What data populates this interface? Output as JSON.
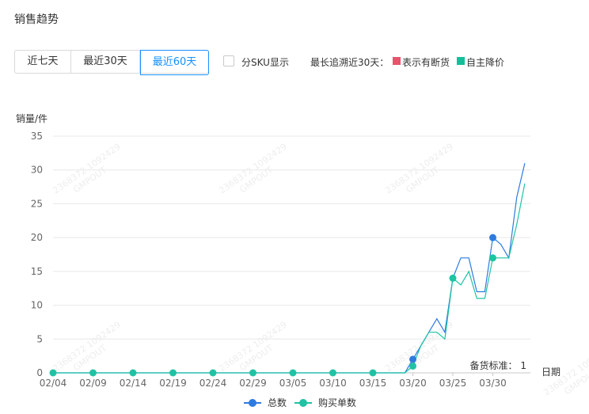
{
  "header": {
    "title": "销售趋势"
  },
  "range_tabs": [
    {
      "label": "近七天",
      "active": false
    },
    {
      "label": "最近30天",
      "active": false
    },
    {
      "label": "最近60天",
      "active": true
    }
  ],
  "sku_toggle": {
    "label": "分SKU显示",
    "checked": false
  },
  "trace_legend": {
    "prefix": "最长追溯近30天：",
    "items": [
      {
        "label": "表示有断货",
        "color": "#e9536b"
      },
      {
        "label": "自主降价",
        "color": "#11c09a"
      }
    ]
  },
  "stock_note": "备货标准： 1",
  "watermark": [
    "2368372 1092429",
    "GMPOUT"
  ],
  "chart_data": {
    "type": "line",
    "ylabel": "销量/件",
    "xlabel": "日期",
    "ylim": [
      0,
      35
    ],
    "yticks": [
      0,
      5,
      10,
      15,
      20,
      25,
      30,
      35
    ],
    "x_tick_labels": [
      "02/04",
      "02/09",
      "02/14",
      "02/19",
      "02/24",
      "02/29",
      "03/05",
      "03/10",
      "03/15",
      "03/20",
      "03/25",
      "03/30"
    ],
    "x_start": "02/04",
    "colors": {
      "总数": "#2e7be0",
      "购买单数": "#1fc3a4"
    },
    "series": [
      {
        "name": "总数",
        "values": [
          0,
          0,
          0,
          0,
          0,
          0,
          0,
          0,
          0,
          0,
          0,
          0,
          0,
          0,
          0,
          0,
          0,
          0,
          0,
          0,
          0,
          0,
          0,
          0,
          0,
          0,
          0,
          0,
          0,
          0,
          0,
          0,
          0,
          0,
          0,
          0,
          0,
          0,
          0,
          0,
          0,
          0,
          0,
          0,
          0,
          2,
          4,
          6,
          8,
          6,
          14,
          17,
          17,
          12,
          12,
          20,
          19,
          17,
          26,
          31
        ],
        "markers": [
          0,
          5,
          10,
          15,
          20,
          25,
          30,
          35,
          40,
          45,
          50,
          55
        ]
      },
      {
        "name": "购买单数",
        "values": [
          0,
          0,
          0,
          0,
          0,
          0,
          0,
          0,
          0,
          0,
          0,
          0,
          0,
          0,
          0,
          0,
          0,
          0,
          0,
          0,
          0,
          0,
          0,
          0,
          0,
          0,
          0,
          0,
          0,
          0,
          0,
          0,
          0,
          0,
          0,
          0,
          0,
          0,
          0,
          0,
          0,
          0,
          0,
          0,
          0,
          1,
          4,
          6,
          6,
          5,
          14,
          13,
          15,
          11,
          11,
          17,
          17,
          17,
          22,
          28
        ],
        "markers": [
          0,
          5,
          10,
          15,
          20,
          25,
          30,
          35,
          40,
          45,
          50,
          55
        ]
      }
    ],
    "legend": {
      "position": "bottom",
      "items": [
        "总数",
        "购买单数"
      ]
    }
  }
}
